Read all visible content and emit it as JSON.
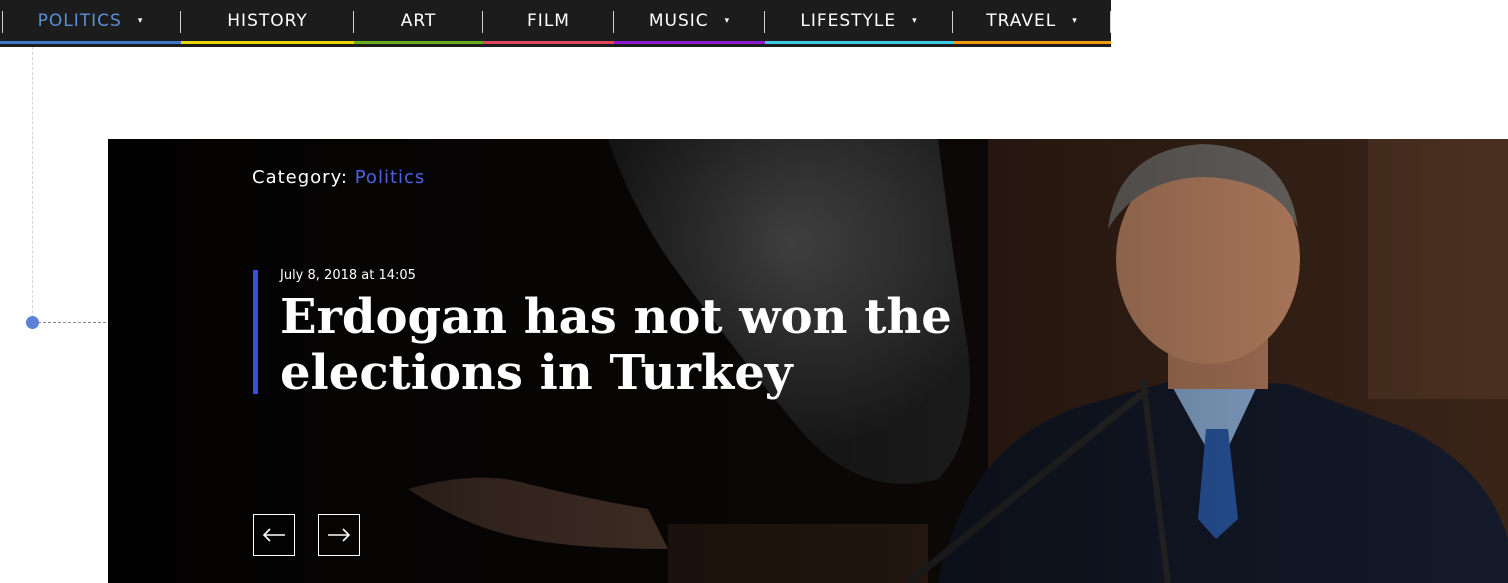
{
  "nav": {
    "items": [
      {
        "label": "POLITICS",
        "caret": "▾",
        "color": "#3f78c9",
        "active": true
      },
      {
        "label": "HISTORY",
        "caret": "",
        "color": "#e8d700"
      },
      {
        "label": "ART",
        "caret": "",
        "color": "#69b021"
      },
      {
        "label": "FILM",
        "caret": "",
        "color": "#e2455f"
      },
      {
        "label": "MUSIC",
        "caret": "▾",
        "color": "#8a1bd1"
      },
      {
        "label": "LIFESTYLE",
        "caret": "▾",
        "color": "#3cc9e3"
      },
      {
        "label": "TRAVEL",
        "caret": "▾",
        "color": "#f29b0f"
      }
    ]
  },
  "hero": {
    "category_prefix": "Category:",
    "category_name": "Politics",
    "date": "July 8, 2018 at 14:05",
    "headline": "Erdogan has not won the elections in Turkey",
    "prev_icon": "arrow-left-icon",
    "next_icon": "arrow-right-icon",
    "accent_color": "#3b4fd8"
  }
}
